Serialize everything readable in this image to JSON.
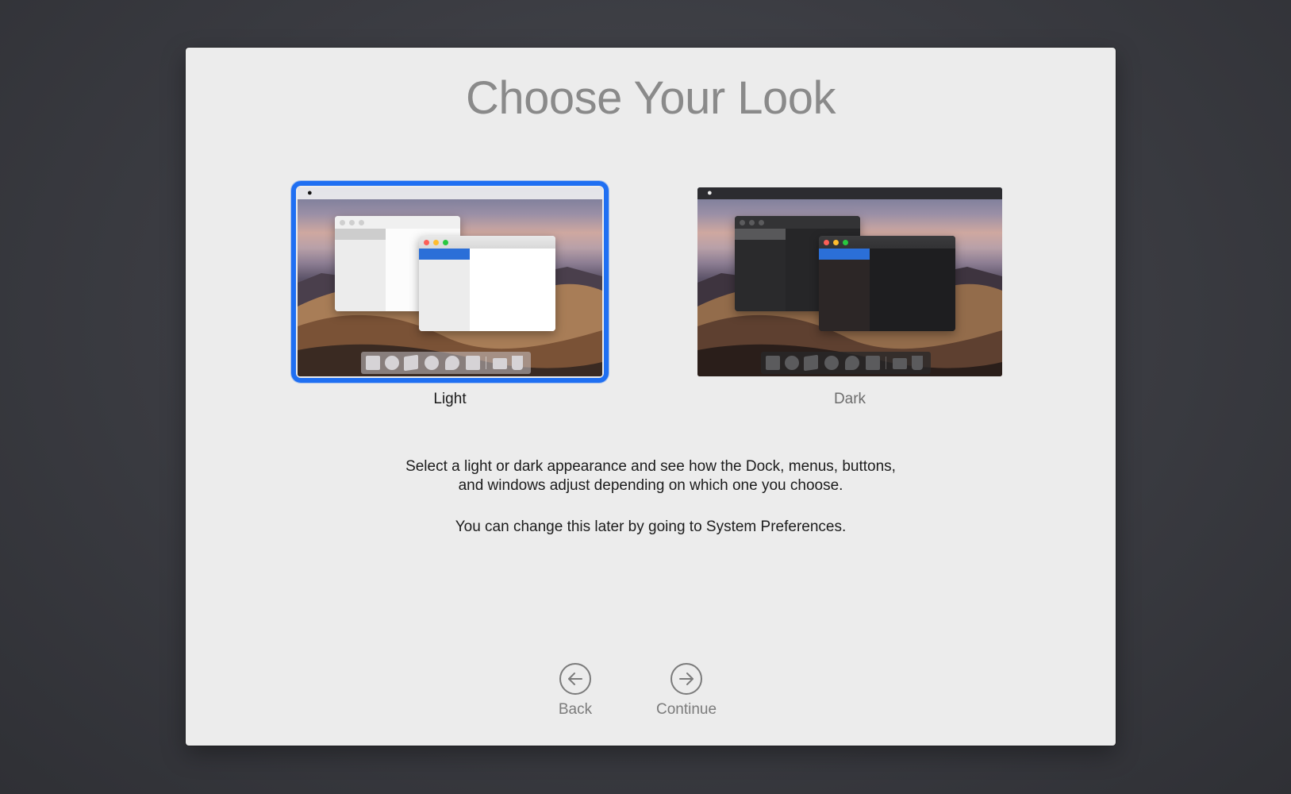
{
  "title": "Choose Your Look",
  "options": {
    "light": {
      "label": "Light",
      "selected": true
    },
    "dark": {
      "label": "Dark",
      "selected": false
    }
  },
  "description": {
    "line1": "Select a light or dark appearance and see how the Dock, menus, buttons,",
    "line2": "and windows adjust depending on which one you choose.",
    "note": "You can change this later by going to System Preferences."
  },
  "navigation": {
    "back_label": "Back",
    "continue_label": "Continue"
  },
  "icons": {
    "back": "arrow-left-circle-icon",
    "continue": "arrow-right-circle-icon",
    "apple": "apple-logo-icon"
  },
  "colors": {
    "accent": "#1f6ff2",
    "panel_background": "#ececec",
    "screen_background": "#3a3b41"
  }
}
